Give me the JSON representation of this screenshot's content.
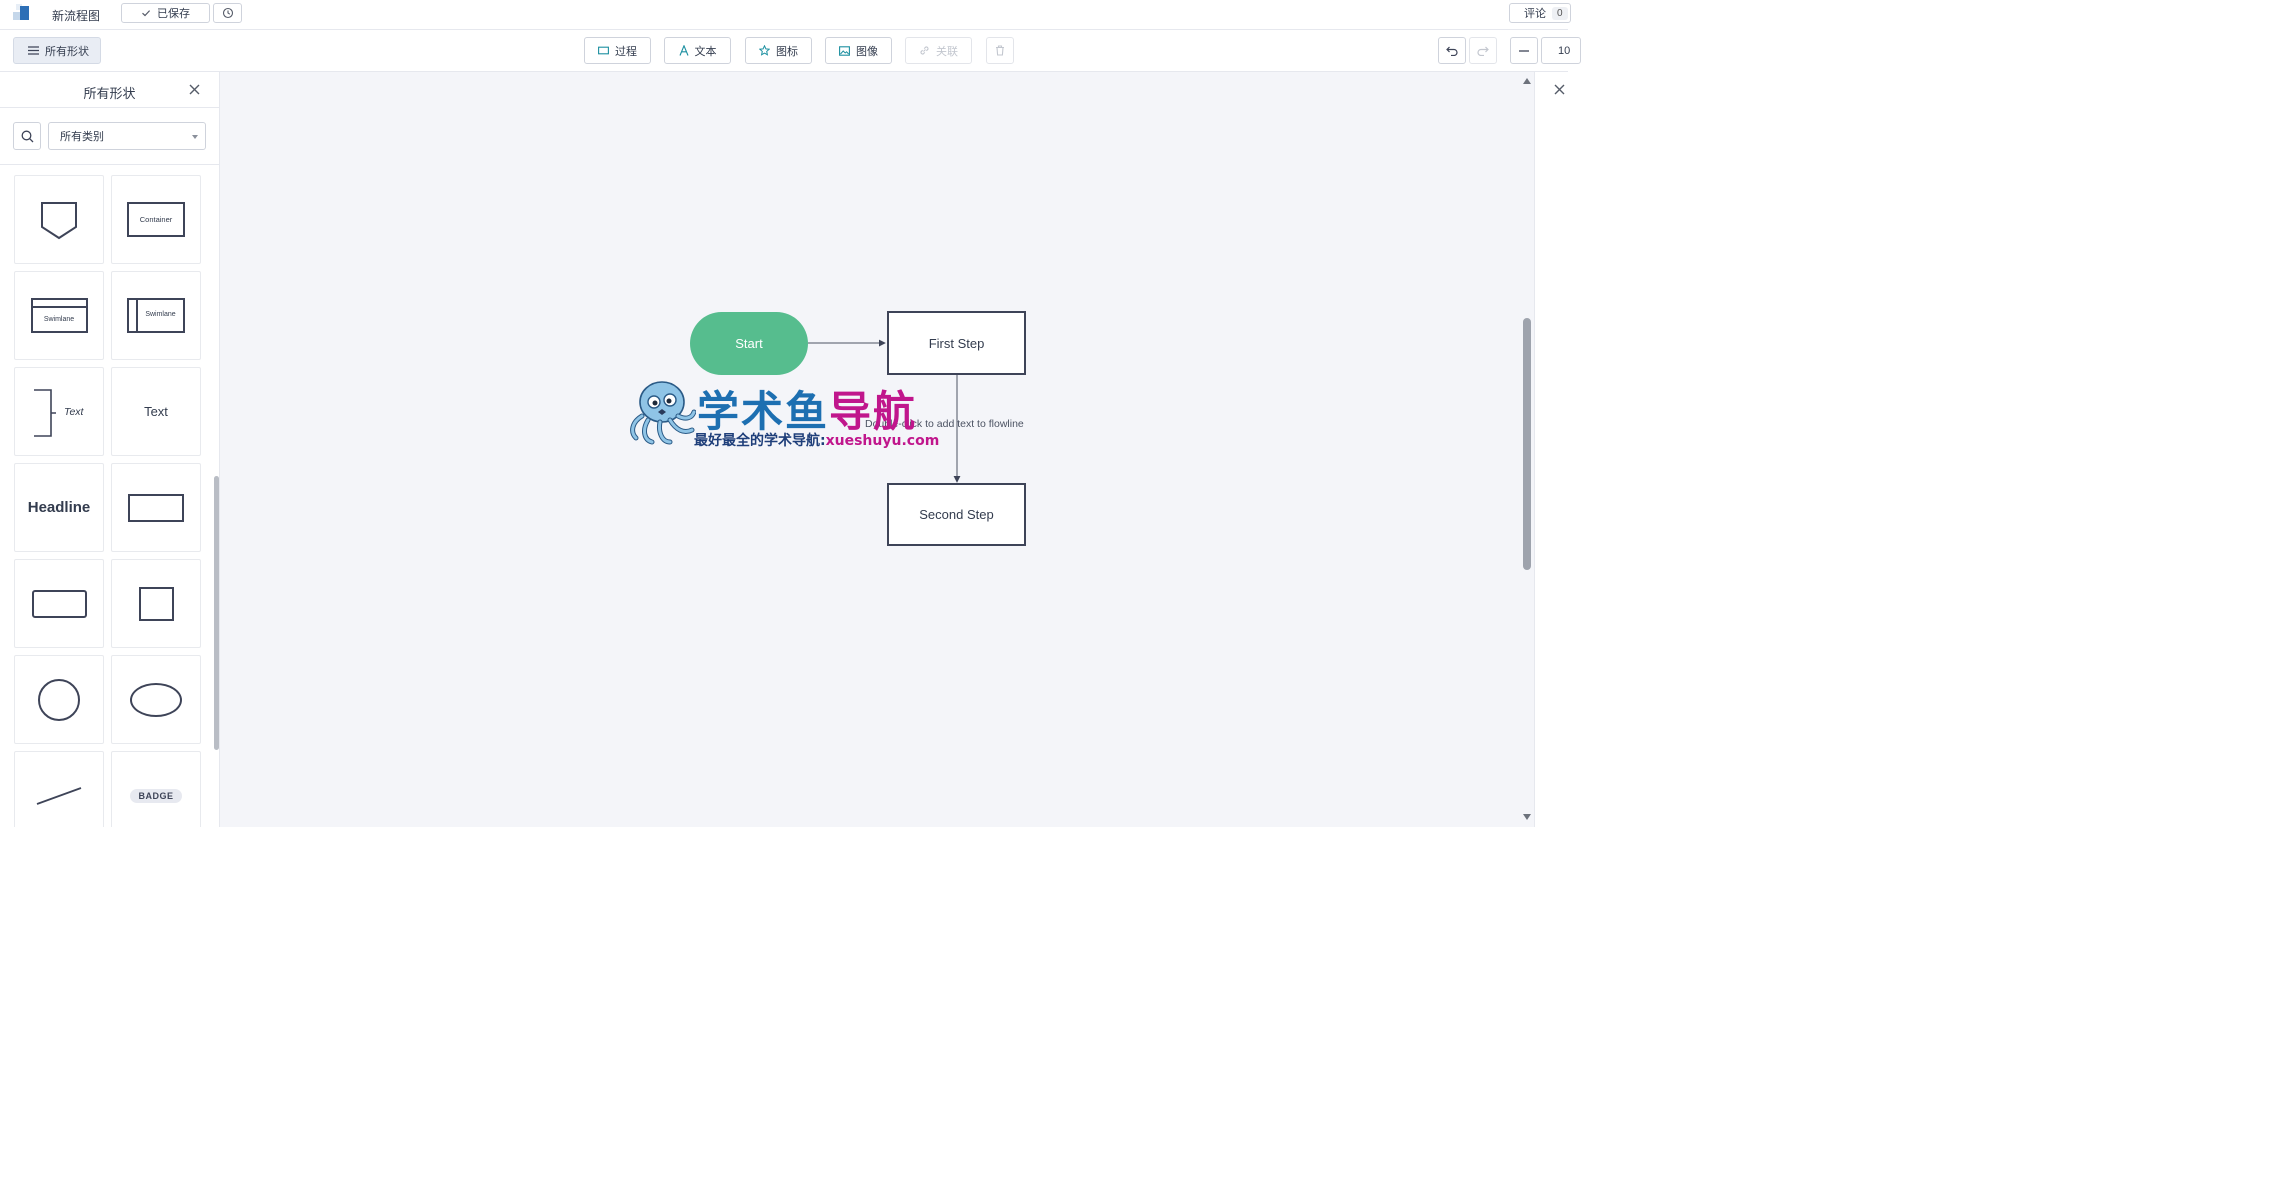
{
  "header": {
    "doc_title": "新流程图",
    "saved_label": "已保存",
    "comment_label": "评论",
    "comment_count": "0"
  },
  "toolbar": {
    "all_shapes_label": "所有形状",
    "process_label": "过程",
    "text_label": "文本",
    "icon_label": "图标",
    "image_label": "图像",
    "link_label": "关联",
    "zoom_partial": "10"
  },
  "left_panel": {
    "title": "所有形状",
    "category_value": "所有类别",
    "shapes": {
      "container_label": "Container",
      "swimlane_h_label": "Swimlane",
      "swimlane_v_label": "Swimlane",
      "annotation_label": "Text",
      "text_label": "Text",
      "headline_label": "Headline",
      "badge_label": "BADGE"
    }
  },
  "canvas": {
    "nodes": {
      "start": "Start",
      "first_step": "First Step",
      "second_step": "Second Step"
    },
    "flowline_hint": "Double-click to add text to flowline"
  },
  "watermark": {
    "title_part1": "学术鱼",
    "title_part2": "导航",
    "subtitle_part1": "最好最全的学术导航:",
    "subtitle_part2": "xueshuyu.com"
  },
  "colors": {
    "start_fill": "#56bd8e",
    "node_border": "#3e4458",
    "canvas_bg": "#f4f5f9",
    "watermark_blue": "#1d6fb1",
    "watermark_magenta": "#c0168c"
  },
  "icons": {
    "app_logo": "app-logo-icon",
    "check": "check-icon",
    "history": "history-icon",
    "menu": "menu-icon",
    "process": "process-rect-icon",
    "text": "text-a-icon",
    "star": "star-icon",
    "image": "image-icon",
    "link": "link-icon",
    "trash": "trash-icon",
    "undo": "undo-icon",
    "redo": "redo-icon",
    "zoom_out": "minus-icon",
    "search": "search-icon",
    "close": "close-icon"
  }
}
